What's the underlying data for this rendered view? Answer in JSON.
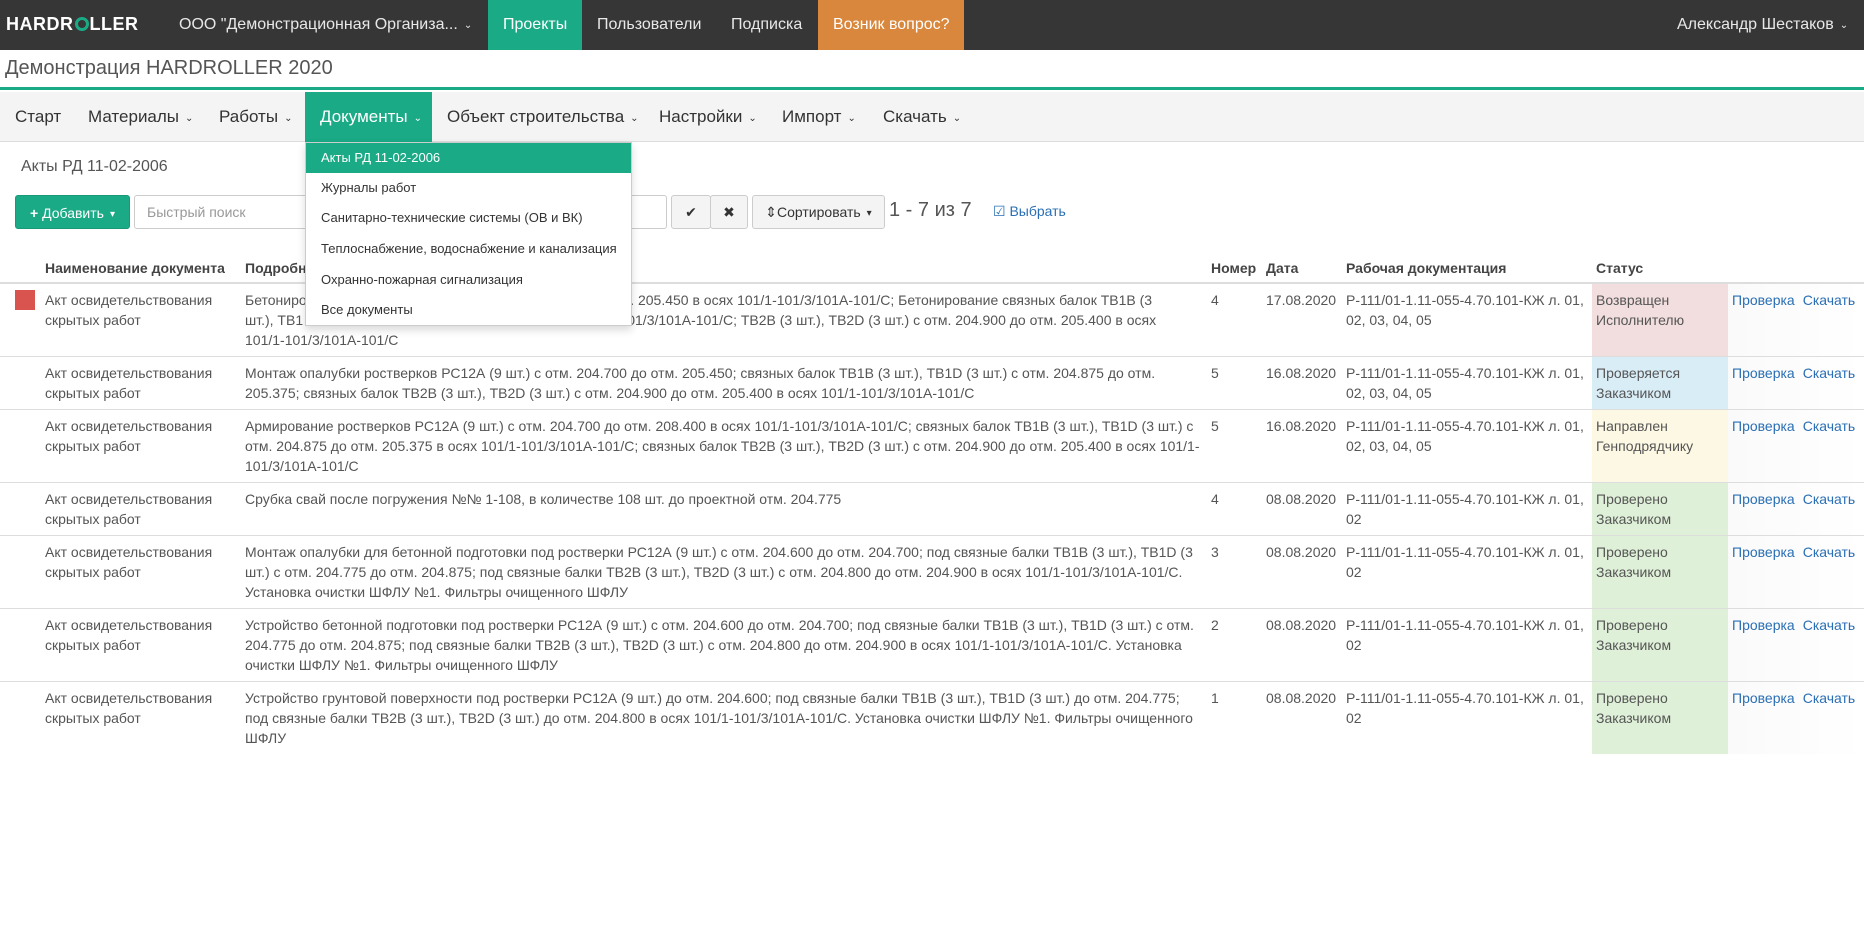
{
  "topbar": {
    "logo_left": "HARDR",
    "logo_right": "LLER",
    "org": "ООО \"Демонстрационная Организа...",
    "nav": [
      "Проекты",
      "Пользователи",
      "Подписка"
    ],
    "help": "Возник вопрос?",
    "user": "Александр Шестаков",
    "accent": "#1aaa86",
    "help_color": "#d9873c"
  },
  "project": {
    "title": "Демонстрация HARDROLLER 2020"
  },
  "menu": {
    "items": [
      "Старт",
      "Материалы",
      "Работы",
      "Документы",
      "Объект строительства",
      "Настройки",
      "Импорт",
      "Скачать"
    ],
    "active": "Документы"
  },
  "dropdown": {
    "items": [
      "Акты РД 11-02-2006",
      "Журналы работ",
      "Санитарно-технические системы (ОВ и ВК)",
      "Теплоснабжение, водоснабжение и канализация",
      "Охранно-пожарная сигнализация",
      "Все документы"
    ]
  },
  "section": {
    "title": "Акты РД 11-02-2006"
  },
  "toolbar": {
    "add_label": "Добавить",
    "search_placeholder": "Быстрый поиск",
    "sort_label": "Сортировать",
    "count": "1 - 7 из 7",
    "select_label": "Выбрать"
  },
  "table": {
    "headers": {
      "name": "Наименование документа",
      "details": "Подробно",
      "number": "Номер",
      "date": "Дата",
      "workdoc": "Рабочая документация",
      "status": "Статус"
    },
    "action_check": "Проверка",
    "action_download": "Скачать",
    "rows": [
      {
        "name": "Акт освидетельствования скрытых работ",
        "details_a": "Бетониро",
        "details_b": "отм. 205.450 в осях 101/1-101/3/101А-101/С; Бетонирование связных балок ТВ1В (3",
        "details_c": "шт.), ТВ1",
        "details_d": "/1-101/3/101А-101/С; ТВ2В (3 шт.), ТВ2D (3 шт.) с отм. 204.900 до отм. 205.400 в осях",
        "details_e": "101/1-101/3/101А-101/С",
        "number": "4",
        "date": "17.08.2020",
        "workdoc": "Р-111/01-1.11-055-4.70.101-КЖ л. 01, 02, 03, 04, 05",
        "status": "Возвращен Исполнителю"
      },
      {
        "name": "Акт освидетельствования скрытых работ",
        "details": "Монтаж опалубки  ростверков РС12А (9 шт.) с отм. 204.700 до отм. 205.450; связных балок ТВ1В (3 шт.), ТВ1D (3 шт.) с отм. 204.875 до отм. 205.375; связных балок ТВ2В (3 шт.), ТВ2D (3 шт.) с отм. 204.900 до отм. 205.400 в осях 101/1-101/3/101А-101/С",
        "number": "5",
        "date": "16.08.2020",
        "workdoc": "Р-111/01-1.11-055-4.70.101-КЖ л. 01, 02, 03, 04, 05",
        "status": "Проверяется Заказчиком"
      },
      {
        "name": "Акт освидетельствования скрытых работ",
        "details": "Армирование ростверков РС12А (9 шт.) с отм. 204.700 до отм. 208.400 в осях 101/1-101/3/101А-101/С; связных балок ТВ1В (3 шт.), ТВ1D (3 шт.) с отм. 204.875 до отм. 205.375 в осях 101/1-101/3/101А-101/С; связных балок ТВ2В (3 шт.), ТВ2D (3 шт.) с отм. 204.900 до отм. 205.400 в осях 101/1-101/3/101А-101/С",
        "number": "5",
        "date": "16.08.2020",
        "workdoc": "Р-111/01-1.11-055-4.70.101-КЖ л. 01, 02, 03, 04, 05",
        "status": "Направлен Генподрядчику"
      },
      {
        "name": "Акт освидетельствования скрытых работ",
        "details": "Срубка свай после погружения  №№ 1-108, в количестве 108 шт. до проектной отм. 204.775",
        "number": "4",
        "date": "08.08.2020",
        "workdoc": "Р-111/01-1.11-055-4.70.101-КЖ л. 01, 02",
        "status": "Проверено Заказчиком"
      },
      {
        "name": "Акт освидетельствования скрытых работ",
        "details": "Монтаж опалубки для бетонной подготовки  под ростверки РС12А (9 шт.) с отм. 204.600 до отм. 204.700; под связные балки ТВ1В (3 шт.), ТВ1D (3 шт.) с отм. 204.775 до отм. 204.875; под связные балки ТВ2В (3 шт.), ТВ2D (3 шт.) с отм. 204.800 до отм. 204.900 в осях 101/1-101/3/101А-101/С. Установка очистки ШФЛУ №1. Фильтры очищенного ШФЛУ",
        "number": "3",
        "date": "08.08.2020",
        "workdoc": "Р-111/01-1.11-055-4.70.101-КЖ л. 01, 02",
        "status": "Проверено Заказчиком"
      },
      {
        "name": "Акт освидетельствования скрытых работ",
        "details": "Устройство бетонной подготовки под ростверки РС12А (9 шт.) с отм. 204.600 до отм. 204.700; под связные балки ТВ1В (3 шт.), ТВ1D (3 шт.) с отм. 204.775 до отм. 204.875; под связные балки ТВ2В (3 шт.), ТВ2D (3 шт.) с отм. 204.800 до отм. 204.900 в осях 101/1-101/3/101А-101/С. Установка очистки ШФЛУ №1. Фильтры очищенного ШФЛУ",
        "number": "2",
        "date": "08.08.2020",
        "workdoc": "Р-111/01-1.11-055-4.70.101-КЖ л. 01, 02",
        "status": "Проверено Заказчиком"
      },
      {
        "name": "Акт освидетельствования скрытых работ",
        "details": "Устройство грунтовой поверхности  под ростверки РС12А (9 шт.) до отм. 204.600; под связные балки ТВ1В (3 шт.), ТВ1D (3 шт.) до отм. 204.775; под связные балки ТВ2В (3 шт.), ТВ2D (3 шт.) до отм. 204.800 в осях 101/1-101/3/101А-101/С. Установка очистки ШФЛУ №1. Фильтры очищенного ШФЛУ",
        "number": "1",
        "date": "08.08.2020",
        "workdoc": "Р-111/01-1.11-055-4.70.101-КЖ л. 01, 02",
        "status": "Проверено Заказчиком"
      }
    ]
  }
}
